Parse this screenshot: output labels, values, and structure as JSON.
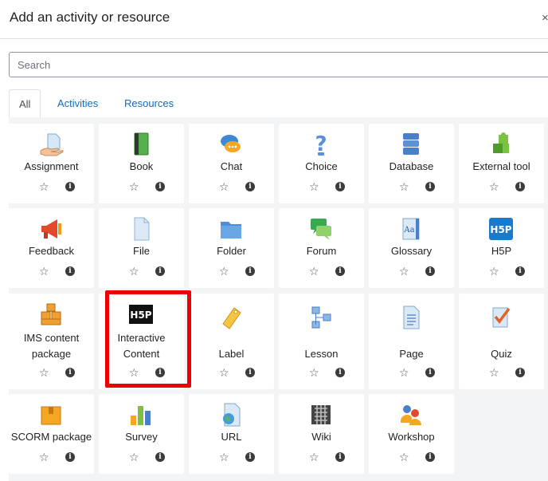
{
  "modal": {
    "title": "Add an activity or resource",
    "close": "×"
  },
  "search": {
    "placeholder": "Search"
  },
  "tabs": [
    {
      "label": "All",
      "active": true
    },
    {
      "label": "Activities",
      "active": false
    },
    {
      "label": "Resources",
      "active": false
    }
  ],
  "icons": {
    "star": "☆",
    "info": "i"
  },
  "colors": {
    "link": "#0f6cbf",
    "highlight": "#ee0000",
    "panel_bg": "#f3f4f6"
  },
  "items": [
    {
      "name": "Assignment",
      "icon": "assignment-icon"
    },
    {
      "name": "Book",
      "icon": "book-icon"
    },
    {
      "name": "Chat",
      "icon": "chat-icon"
    },
    {
      "name": "Choice",
      "icon": "choice-icon"
    },
    {
      "name": "Database",
      "icon": "database-icon"
    },
    {
      "name": "External tool",
      "icon": "external-tool-icon"
    },
    {
      "name": "Feedback",
      "icon": "feedback-icon"
    },
    {
      "name": "File",
      "icon": "file-icon"
    },
    {
      "name": "Folder",
      "icon": "folder-icon"
    },
    {
      "name": "Forum",
      "icon": "forum-icon"
    },
    {
      "name": "Glossary",
      "icon": "glossary-icon"
    },
    {
      "name": "H5P",
      "icon": "h5p-icon",
      "icon_text": "H5P"
    },
    {
      "name": "IMS content",
      "name2": "package",
      "icon": "ims-content-package-icon"
    },
    {
      "name": "Interactive",
      "name2": "Content",
      "icon": "interactive-content-icon",
      "icon_text": "H5P",
      "highlighted": true
    },
    {
      "name": "Label",
      "icon": "label-icon"
    },
    {
      "name": "Lesson",
      "icon": "lesson-icon"
    },
    {
      "name": "Page",
      "icon": "page-icon"
    },
    {
      "name": "Quiz",
      "icon": "quiz-icon"
    },
    {
      "name": "SCORM package",
      "icon": "scorm-package-icon"
    },
    {
      "name": "Survey",
      "icon": "survey-icon"
    },
    {
      "name": "URL",
      "icon": "url-icon"
    },
    {
      "name": "Wiki",
      "icon": "wiki-icon"
    },
    {
      "name": "Workshop",
      "icon": "workshop-icon"
    }
  ]
}
